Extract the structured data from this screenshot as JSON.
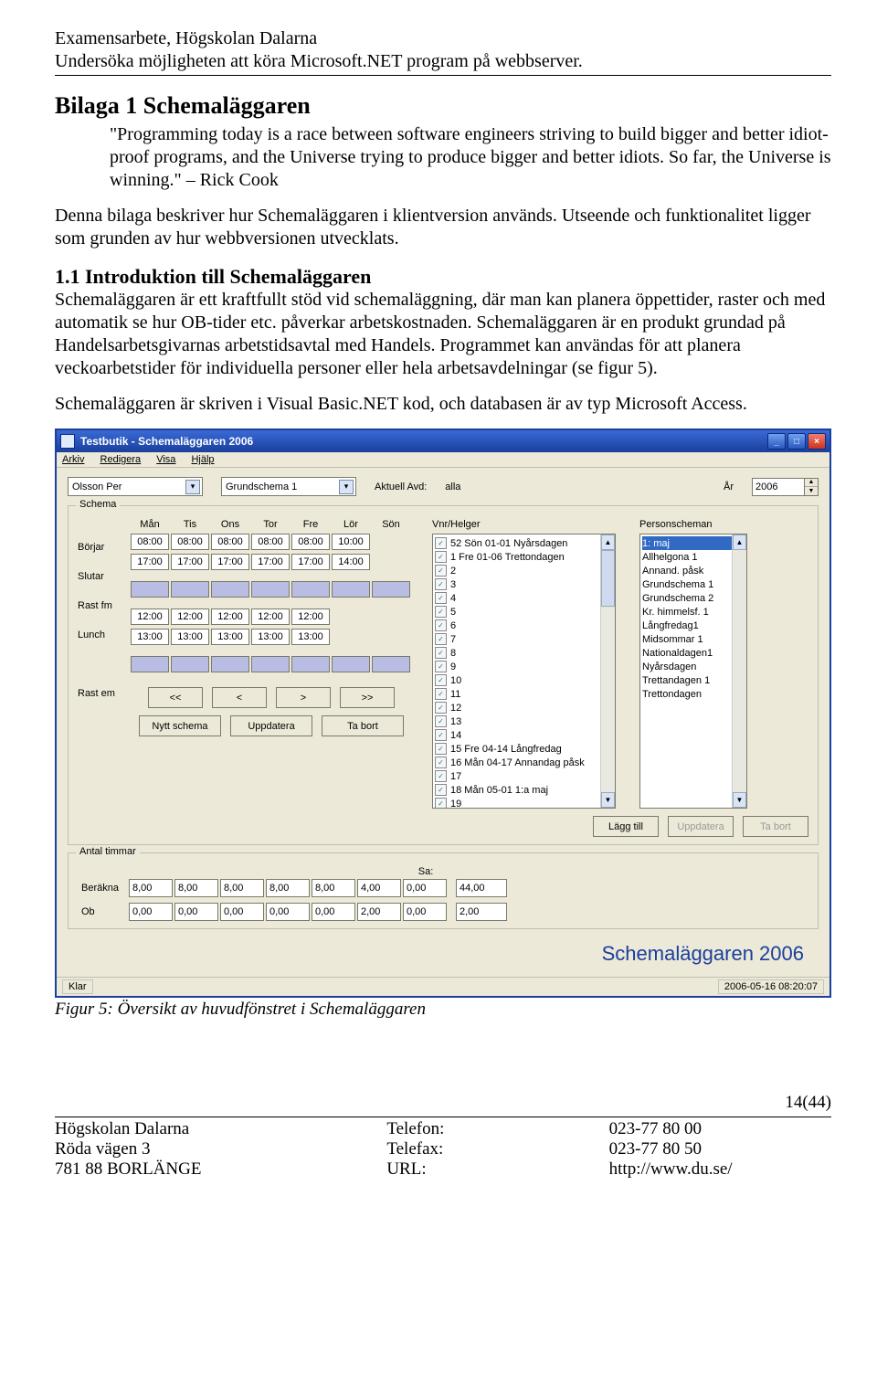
{
  "doc": {
    "header_line1": "Examensarbete, Högskolan Dalarna",
    "header_line2": "Undersöka möjligheten att köra Microsoft.NET program på webbserver.",
    "h1": "Bilaga 1 Schemaläggaren",
    "quote": "\"Programming today is a race between software engineers striving to build bigger and better idiot-proof programs, and the Universe trying to produce bigger and better idiots. So far, the Universe is winning.\" – Rick Cook",
    "para1": "Denna bilaga beskriver hur Schemaläggaren i klientversion används. Utseende och funktionalitet ligger som grunden av hur webbversionen utvecklats.",
    "h2": "1.1 Introduktion till Schemaläggaren",
    "para2": "Schemaläggaren är ett kraftfullt stöd vid schemaläggning, där man kan planera öppettider, raster och med automatik se hur OB-tider etc. påverkar arbetskostnaden. Schemaläggaren är en produkt grundad på Handelsarbetsgivarnas arbetstidsavtal med Handels. Programmet kan användas för att planera veckoarbetstider för individuella personer eller hela arbetsavdelningar (se figur 5).",
    "para3": "Schemaläggaren är skriven i Visual Basic.NET kod, och databasen är av typ Microsoft Access.",
    "caption": "Figur 5: Översikt av huvudfönstret i Schemaläggaren",
    "pagenum": "14(44)"
  },
  "footer": {
    "org": "Högskolan Dalarna",
    "addr": "Röda vägen 3",
    "zip": "781 88  BORLÄNGE",
    "tel_lbl": "Telefon:",
    "fax_lbl": "Telefax:",
    "url_lbl": "URL:",
    "tel": "023-77 80 00",
    "fax": "023-77 80 50",
    "url": "http://www.du.se/"
  },
  "app": {
    "title": "Testbutik - Schemaläggaren 2006",
    "menus": [
      "Arkiv",
      "Redigera",
      "Visa",
      "Hjälp"
    ],
    "person": "Olsson Per",
    "schema": "Grundschema 1",
    "avd_label": "Aktuell Avd:",
    "avd_value": "alla",
    "year_label": "År",
    "year_value": "2006",
    "group_schema": "Schema",
    "days": [
      "Mån",
      "Tis",
      "Ons",
      "Tor",
      "Fre",
      "Lör",
      "Sön"
    ],
    "rowlabels": [
      "Börjar",
      "Slutar",
      "Rast fm",
      "Lunch",
      "",
      "Rast em"
    ],
    "grid": {
      "borjar": [
        "08:00",
        "08:00",
        "08:00",
        "08:00",
        "08:00",
        "10:00",
        ""
      ],
      "slutar": [
        "17:00",
        "17:00",
        "17:00",
        "17:00",
        "17:00",
        "14:00",
        ""
      ],
      "rastfm": [
        "shade",
        "shade",
        "shade",
        "shade",
        "shade",
        "shade",
        "shade"
      ],
      "lunch1": [
        "12:00",
        "12:00",
        "12:00",
        "12:00",
        "12:00",
        "",
        ""
      ],
      "lunch2": [
        "13:00",
        "13:00",
        "13:00",
        "13:00",
        "13:00",
        "",
        ""
      ],
      "rastem": [
        "shade",
        "shade",
        "shade",
        "shade",
        "shade",
        "shade",
        "shade"
      ]
    },
    "nav": {
      "first": "<<",
      "prev": "<",
      "next": ">",
      "last": ">>"
    },
    "btn_new": "Nytt schema",
    "btn_upd": "Uppdatera",
    "btn_del": "Ta bort",
    "vnr_label": "Vnr/Helger",
    "vnr_items": [
      {
        "c": true,
        "t": "52 Sön 01-01 Nyårsdagen"
      },
      {
        "c": true,
        "t": "1 Fre 01-06 Trettondagen"
      },
      {
        "c": true,
        "t": "2"
      },
      {
        "c": true,
        "t": "3"
      },
      {
        "c": true,
        "t": "4"
      },
      {
        "c": true,
        "t": "5"
      },
      {
        "c": true,
        "t": "6"
      },
      {
        "c": true,
        "t": "7"
      },
      {
        "c": true,
        "t": "8"
      },
      {
        "c": true,
        "t": "9"
      },
      {
        "c": true,
        "t": "10"
      },
      {
        "c": true,
        "t": "11"
      },
      {
        "c": true,
        "t": "12"
      },
      {
        "c": true,
        "t": "13"
      },
      {
        "c": true,
        "t": "14"
      },
      {
        "c": true,
        "t": "15 Fre 04-14 Långfredag"
      },
      {
        "c": true,
        "t": "16 Mån 04-17 Annandag påsk"
      },
      {
        "c": true,
        "t": "17"
      },
      {
        "c": true,
        "t": "18 Mån 05-01 1:a maj"
      },
      {
        "c": true,
        "t": "19"
      }
    ],
    "person_label": "Personscheman",
    "person_items": [
      "1: maj",
      "Allhelgona 1",
      "Annand. påsk",
      "Grundschema 1",
      "Grundschema 2",
      "Kr. himmelsf. 1",
      "Långfredag1",
      "Midsommar 1",
      "Nationaldagen1",
      "Nyårsdagen",
      "Trettandagen 1",
      "Trettondagen"
    ],
    "btn_add": "Lägg till",
    "btn_upd2": "Uppdatera",
    "btn_del2": "Ta bort",
    "group_hours": "Antal timmar",
    "sa_label": "Sa:",
    "berakna_lbl": "Beräkna",
    "ob_lbl": "Ob",
    "berakna": [
      "8,00",
      "8,00",
      "8,00",
      "8,00",
      "8,00",
      "4,00",
      "0,00",
      "44,00"
    ],
    "ob": [
      "0,00",
      "0,00",
      "0,00",
      "0,00",
      "0,00",
      "2,00",
      "0,00",
      "2,00"
    ],
    "brand": "Schemaläggaren 2006",
    "status_left": "Klar",
    "status_right": "2006-05-16  08:20:07"
  }
}
